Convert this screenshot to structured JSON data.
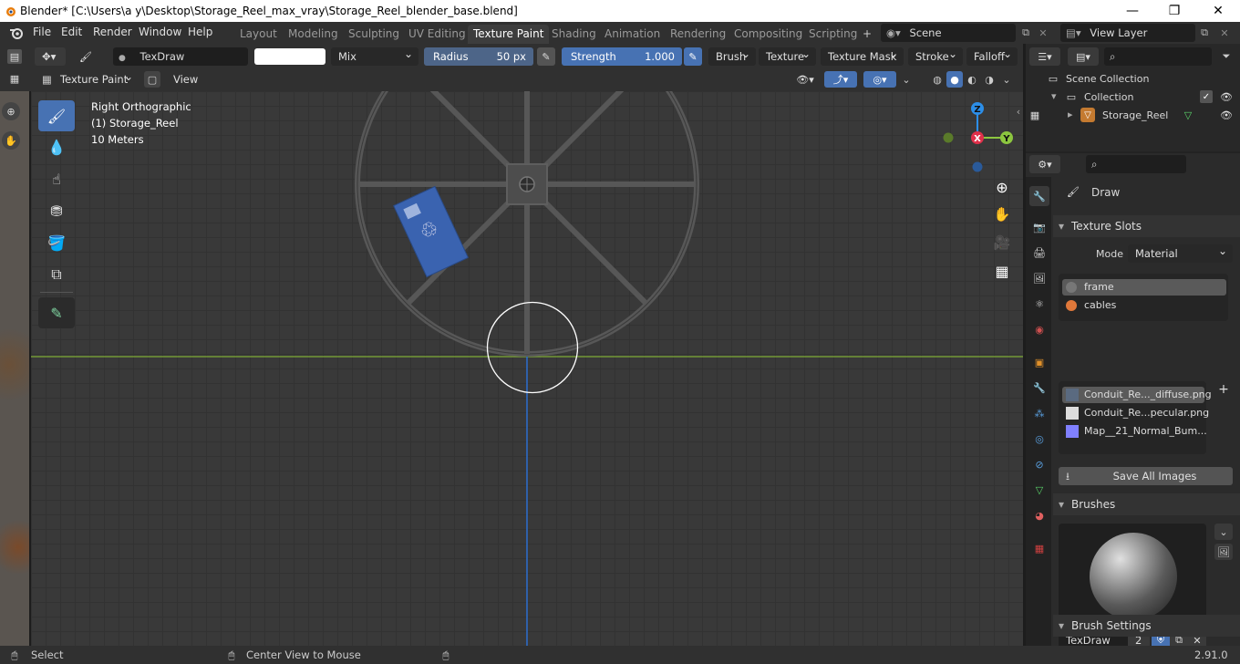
{
  "window": {
    "title": "Blender* [C:\\Users\\a y\\Desktop\\Storage_Reel_max_vray\\Storage_Reel_blender_base.blend]"
  },
  "menu": {
    "items": [
      "File",
      "Edit",
      "Render",
      "Window",
      "Help"
    ]
  },
  "workspaces": [
    "Layout",
    "Modeling",
    "Sculpting",
    "UV Editing",
    "Texture Paint",
    "Shading",
    "Animation",
    "Rendering",
    "Compositing",
    "Scripting"
  ],
  "active_workspace": "Texture Paint",
  "scene": {
    "name": "Scene",
    "view_layer": "View Layer"
  },
  "tool_header": {
    "brush_name": "TexDraw",
    "blend_mode": "Mix",
    "radius_label": "Radius",
    "radius_value": "50 px",
    "strength_label": "Strength",
    "strength_value": "1.000",
    "brush_menu": "Brush",
    "texture_menu": "Texture",
    "texture_mask_menu": "Texture Mask",
    "stroke_menu": "Stroke",
    "falloff_menu": "Falloff",
    "mode": "Texture Paint",
    "view_menu": "View"
  },
  "viewport": {
    "view_name": "Right Orthographic",
    "object": "(1) Storage_Reel",
    "scale": "10 Meters",
    "axes": {
      "z": "Z",
      "x": "X",
      "y": "Y"
    }
  },
  "outliner": {
    "scene_collection": "Scene Collection",
    "collection": "Collection",
    "object": "Storage_Reel"
  },
  "properties": {
    "tool_name": "Draw",
    "texture_slots_title": "Texture Slots",
    "mode_label": "Mode",
    "mode_value": "Material",
    "materials": [
      "frame",
      "cables"
    ],
    "images": [
      "Conduit_Re..._diffuse.png",
      "Conduit_Re...pecular.png",
      "Map__21_Normal_Bum..."
    ],
    "save_all_images": "Save All Images",
    "brushes_title": "Brushes",
    "brush_name": "TexDraw",
    "brush_users": "2",
    "brush_settings_title": "Brush Settings"
  },
  "status": {
    "select": "Select",
    "center_view": "Center View to Mouse",
    "version": "2.91.0"
  },
  "colors": {
    "accent": "#4772b3",
    "x_axis": "#e0304a",
    "y_axis": "#8cc63f",
    "z_axis": "#2c8ee8"
  }
}
